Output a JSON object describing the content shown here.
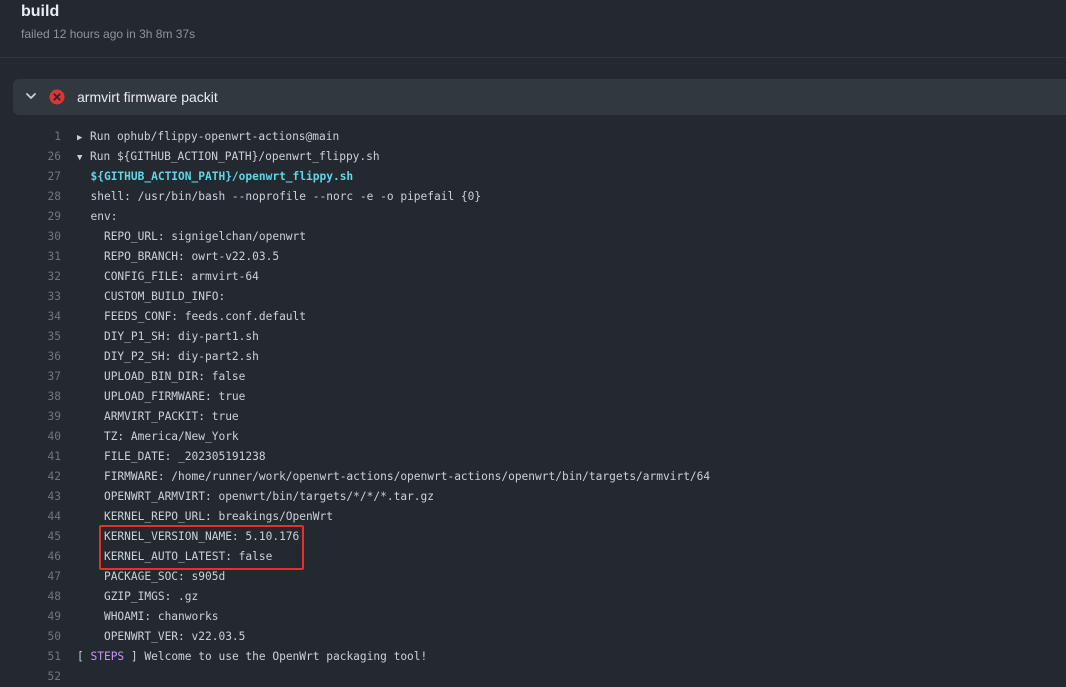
{
  "job": {
    "title": "build",
    "status_text": "failed 12 hours ago in 3h 8m 37s"
  },
  "step": {
    "name": "armvirt firmware packit",
    "status": "failed",
    "status_color": "#da3633",
    "expanded": true
  },
  "log_lines": [
    {
      "num": "1",
      "indent": "",
      "marker": "collapsed",
      "text": "Run ophub/flippy-openwrt-actions@main"
    },
    {
      "num": "26",
      "indent": "",
      "marker": "expanded",
      "text": "Run ${GITHUB_ACTION_PATH}/openwrt_flippy.sh"
    },
    {
      "num": "27",
      "indent": "  ",
      "marker": "",
      "style": "cmd",
      "text": "${GITHUB_ACTION_PATH}/openwrt_flippy.sh"
    },
    {
      "num": "28",
      "indent": "  ",
      "marker": "",
      "text": "shell: /usr/bin/bash --noprofile --norc -e -o pipefail {0}"
    },
    {
      "num": "29",
      "indent": "  ",
      "marker": "",
      "text": "env:"
    },
    {
      "num": "30",
      "indent": "    ",
      "marker": "",
      "text": "REPO_URL: signigelchan/openwrt"
    },
    {
      "num": "31",
      "indent": "    ",
      "marker": "",
      "text": "REPO_BRANCH: owrt-v22.03.5"
    },
    {
      "num": "32",
      "indent": "    ",
      "marker": "",
      "text": "CONFIG_FILE: armvirt-64"
    },
    {
      "num": "33",
      "indent": "    ",
      "marker": "",
      "text": "CUSTOM_BUILD_INFO:"
    },
    {
      "num": "34",
      "indent": "    ",
      "marker": "",
      "text": "FEEDS_CONF: feeds.conf.default"
    },
    {
      "num": "35",
      "indent": "    ",
      "marker": "",
      "text": "DIY_P1_SH: diy-part1.sh"
    },
    {
      "num": "36",
      "indent": "    ",
      "marker": "",
      "text": "DIY_P2_SH: diy-part2.sh"
    },
    {
      "num": "37",
      "indent": "    ",
      "marker": "",
      "text": "UPLOAD_BIN_DIR: false"
    },
    {
      "num": "38",
      "indent": "    ",
      "marker": "",
      "text": "UPLOAD_FIRMWARE: true"
    },
    {
      "num": "39",
      "indent": "    ",
      "marker": "",
      "text": "ARMVIRT_PACKIT: true"
    },
    {
      "num": "40",
      "indent": "    ",
      "marker": "",
      "text": "TZ: America/New_York"
    },
    {
      "num": "41",
      "indent": "    ",
      "marker": "",
      "text": "FILE_DATE: _202305191238"
    },
    {
      "num": "42",
      "indent": "    ",
      "marker": "",
      "text": "FIRMWARE: /home/runner/work/openwrt-actions/openwrt-actions/openwrt/bin/targets/armvirt/64"
    },
    {
      "num": "43",
      "indent": "    ",
      "marker": "",
      "text": "OPENWRT_ARMVIRT: openwrt/bin/targets/*/*/*.tar.gz"
    },
    {
      "num": "44",
      "indent": "    ",
      "marker": "",
      "text": "KERNEL_REPO_URL: breakings/OpenWrt"
    },
    {
      "num": "45",
      "indent": "    ",
      "marker": "",
      "text": "KERNEL_VERSION_NAME: 5.10.176"
    },
    {
      "num": "46",
      "indent": "    ",
      "marker": "",
      "text": "KERNEL_AUTO_LATEST: false"
    },
    {
      "num": "47",
      "indent": "    ",
      "marker": "",
      "text": "PACKAGE_SOC: s905d"
    },
    {
      "num": "48",
      "indent": "    ",
      "marker": "",
      "text": "GZIP_IMGS: .gz"
    },
    {
      "num": "49",
      "indent": "    ",
      "marker": "",
      "text": "WHOAMI: chanworks"
    },
    {
      "num": "50",
      "indent": "    ",
      "marker": "",
      "text": "OPENWRT_VER: v22.03.5"
    },
    {
      "num": "51",
      "indent": "",
      "marker": "",
      "style": "steps",
      "prefix": "[ ",
      "keyword": "STEPS",
      "text": " ] Welcome to use the OpenWrt packaging tool!"
    },
    {
      "num": "52",
      "indent": "",
      "marker": "",
      "text": ""
    }
  ],
  "annotation": {
    "highlight_color": "#e5302d",
    "highlighted_lines": [
      "45",
      "46"
    ]
  }
}
